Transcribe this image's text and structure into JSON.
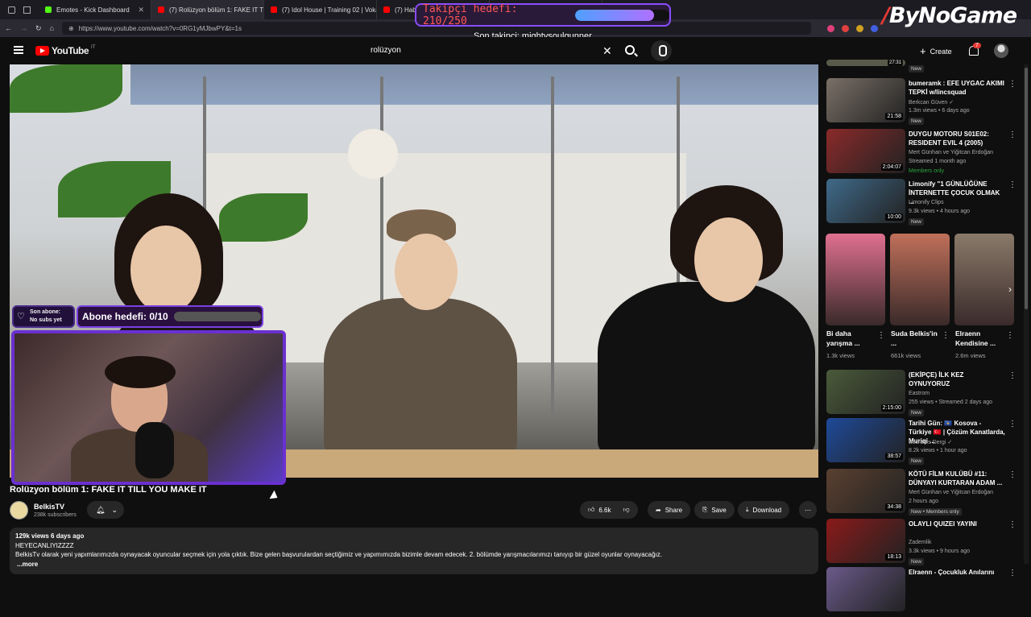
{
  "browser": {
    "tabs": [
      {
        "label": "Emotes - Kick Dashboard",
        "color": "#53fc18",
        "active": false
      },
      {
        "label": "(7) Rolüzyon bölüm 1: FAKE IT TILL",
        "color": "#ff0000",
        "active": true
      },
      {
        "label": "(7) Idol House | Training 02 | Vokal",
        "color": "#ff0000",
        "active": false
      },
      {
        "label": "(7) Haberti",
        "color": "#ff0000",
        "active": false
      },
      {
        "label": "OWER (Live",
        "color": "#ff0000",
        "active": false
      }
    ],
    "url": "https://www.youtube.com/watch?v=0RG1yMJbwPY&t=1s"
  },
  "overlay": {
    "follower_goal_label": "Takipçi hedefi: 210/250",
    "follower_goal_fraction": 0.84,
    "last_follower": "Son takipçi: mightysoulgunner",
    "brand": "ByNoGame",
    "last_sub_line1": "Son abone:",
    "last_sub_line2": "No subs yet",
    "sub_goal_label": "Abone hedefi: 0/10",
    "sub_goal_fraction": 0
  },
  "youtube": {
    "logo": "YouTube",
    "region": "IT",
    "search_query": "rolüzyon",
    "create_label": "Create",
    "notifications": "7"
  },
  "video": {
    "title": "Rolüzyon bölüm 1: FAKE IT TILL YOU MAKE IT",
    "channel": "BelkisTV",
    "subscribers": "238k subscribers",
    "likes": "6.6k",
    "share": "Share",
    "save": "Save",
    "download": "Download",
    "views_date": "129k views  6 days ago",
    "desc_line1": "HEYECANLIYIZZZZ",
    "desc_line2": "BelkisTv olarak yeni yapımlarımızda oynayacak oyuncular seçmek için yola çıktık. Bize gelen başvurulardan seçtiğimiz ve yapımımızda bizimle devam edecek. 2. bölümde yarışmacılarımızı tanıyıp bir güzel oyunlar oynayacağız.",
    "more": "...more"
  },
  "sidebar": {
    "top_stub": {
      "duration": "27:31",
      "badge": "New"
    },
    "cards": [
      {
        "title": "bumeramk : EFE UYGAC AKIMI TEPKİ w/lincsquad",
        "channel": "Berkcan Güven ✓",
        "meta": "1.3m views • 6 days ago",
        "badge": "New",
        "duration": "21:58",
        "thumb": "#7a7067"
      },
      {
        "title": "DUYGU MOTORU S01E02: RESIDENT EVIL 4 (2005)",
        "channel": "Mert Günhan ve Yiğitcan Erdoğan",
        "meta": "Streamed 1 month ago",
        "badge": "Members only",
        "duration": "2:04:07",
        "thumb": "#8b2a2a"
      },
      {
        "title": "Limonify \"1 GÜNLÜĞÜNE İNTERNETTE ÇOCUK OLMAK ...",
        "channel": "Limonify Clips",
        "meta": "9.3k views • 4 hours ago",
        "badge": "New",
        "duration": "10:00",
        "thumb": "#3f6a8a"
      },
      {
        "title": "(EKİPÇE) İLK KEZ OYNUYORUZ",
        "channel": "Eastrom",
        "meta": "255 views • Streamed 2 days ago",
        "badge": "New",
        "duration": "2:15:00",
        "thumb": "#4a5a3a"
      },
      {
        "title": "Tarihi Gün: 🇽🇰 Kosova - Türkiye 🇹🇷 | Çözüm Kanatlarda, Muriqi ...",
        "channel": "Socrates Dergi ✓",
        "meta": "8.2k views • 1 hour ago",
        "badge": "New",
        "duration": "38:57",
        "thumb": "#1e4a9a"
      },
      {
        "title": "KÖTÜ FİLM KULÜBÜ #11: DÜNYAYI KURTARAN ADAM ...",
        "channel": "Mert Günhan ve Yiğitcan Erdoğan",
        "meta": "2 hours ago",
        "badge": "New • Members only",
        "duration": "34:38",
        "thumb": "#5a4030"
      },
      {
        "title": "OLAYLI QUIZEI YAYINI",
        "channel": "Zademlik",
        "meta": "3.3k views • 9 hours ago",
        "badge": "New",
        "duration": "18:13",
        "thumb": "#8a1a1a"
      },
      {
        "title": "Elraenn - Çocukluk Anılarını",
        "channel": "",
        "meta": "",
        "badge": "",
        "duration": "",
        "thumb": "#6a5a8a"
      }
    ],
    "shorts": [
      {
        "title": "Bi daha yarışma ...",
        "views": "1.3k views",
        "thumb": "#e07090"
      },
      {
        "title": "Suda Belkis'in ...",
        "views": "661k views",
        "thumb": "#c0705a"
      },
      {
        "title": "Elraenn Kendisine ...",
        "views": "2.6m views",
        "thumb": "#8a7a6a"
      }
    ]
  }
}
